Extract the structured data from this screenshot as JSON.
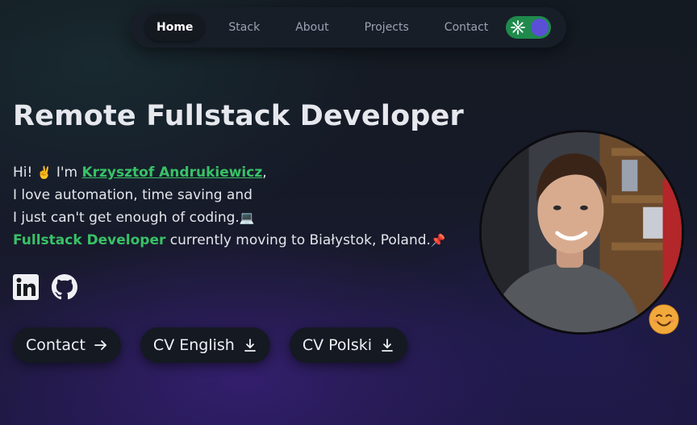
{
  "nav": {
    "links": [
      {
        "label": "Home",
        "active": true
      },
      {
        "label": "Stack",
        "active": false
      },
      {
        "label": "About",
        "active": false
      },
      {
        "label": "Projects",
        "active": false
      },
      {
        "label": "Contact",
        "active": false
      }
    ],
    "toggle_icon": "sun-icon"
  },
  "hero": {
    "title": "Remote Fullstack Developer",
    "line1_prefix": "Hi! ",
    "line1_emoji": "✌️",
    "line1_mid": " I'm ",
    "name": "Krzysztof Andrukiewicz",
    "line1_suffix": ",",
    "line2": "I love automation, time saving and",
    "line3": "I just can't get enough of coding.",
    "line3_emoji": "💻",
    "role": "Fullstack Developer",
    "line4_rest": " currently moving to Białystok, Poland.",
    "line4_emoji": "📌"
  },
  "socials": [
    {
      "icon": "linkedin-icon"
    },
    {
      "icon": "github-icon"
    }
  ],
  "buttons": {
    "contact": "Contact",
    "cv_english": "CV English",
    "cv_polski": "CV Polski"
  },
  "colors": {
    "accent_green": "#39c167",
    "toggle_bg": "#1f8a4c",
    "toggle_knob": "#5b4fd6"
  }
}
